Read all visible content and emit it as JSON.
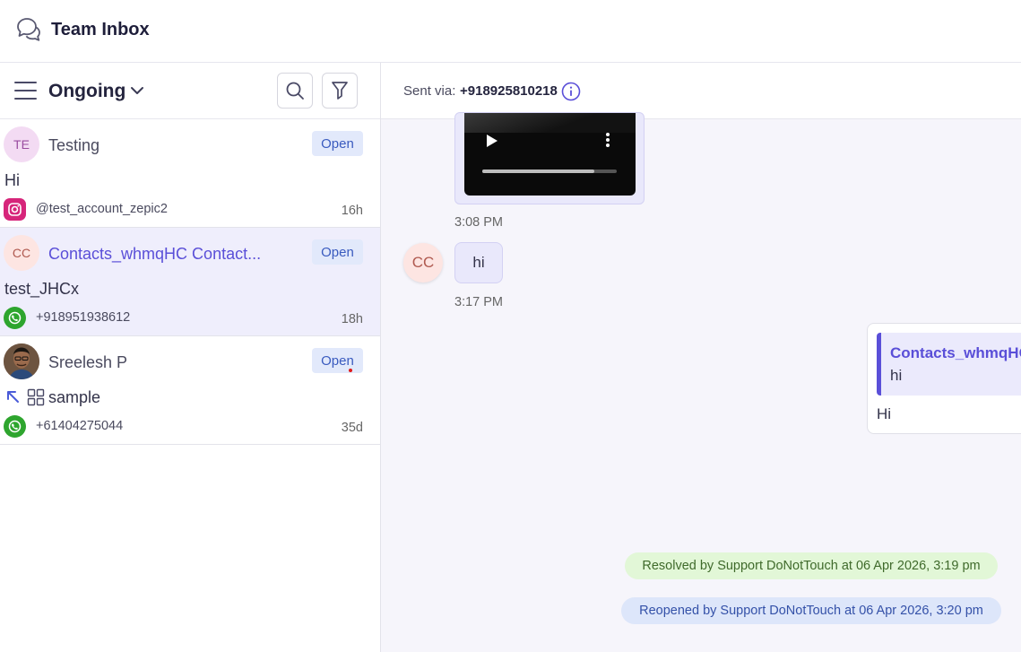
{
  "header": {
    "title": "Team Inbox",
    "logo_icon": "chat-bubbles-icon"
  },
  "list_panel": {
    "filter_label": "Ongoing",
    "search_icon": "search-icon",
    "filter_icon": "funnel-icon",
    "conversations": [
      {
        "avatar_initials": "TE",
        "name": "Testing",
        "status": "Open",
        "preview": "Hi",
        "channel": "instagram-icon",
        "handle": "@test_account_zepic2",
        "time": "16h",
        "active": false
      },
      {
        "avatar_initials": "CC",
        "name": "Contacts_whmqHC Contact...",
        "status": "Open",
        "preview": "test_JHCx",
        "channel": "whatsapp-icon",
        "handle": "+918951938612",
        "time": "18h",
        "active": true
      },
      {
        "avatar_initials": "",
        "name": "Sreelesh P",
        "status": "Open",
        "preview": "sample",
        "channel": "whatsapp-icon",
        "handle": "+61404275044",
        "time": "35d",
        "active": false
      }
    ]
  },
  "chat": {
    "sent_via_label": "Sent via:",
    "sent_via_number": "+918925810218",
    "video_progress": 0.83,
    "messages": [
      {
        "type": "video",
        "time": "3:08 PM"
      },
      {
        "type": "text",
        "direction": "in",
        "avatar_initials": "CC",
        "text": "hi",
        "time": "3:17 PM"
      },
      {
        "type": "reply",
        "direction": "out",
        "quoted_name": "Contacts_whmqHC",
        "quoted_text": "hi",
        "text": "Hi"
      }
    ],
    "events": {
      "resolved": "Resolved by Support DoNotTouch at 06 Apr 2026, 3:19 pm",
      "reopened": "Reopened by Support DoNotTouch at 06 Apr 2026, 3:20 pm"
    }
  },
  "colors": {
    "accent": "#5a4fd8",
    "active_row": "#efeefc",
    "status_badge_bg": "#e2e9fb",
    "resolved_bg": "#e2f7d7",
    "reopened_bg": "#dde6fa",
    "whatsapp": "#2ea52e",
    "instagram": "#d6257a"
  }
}
